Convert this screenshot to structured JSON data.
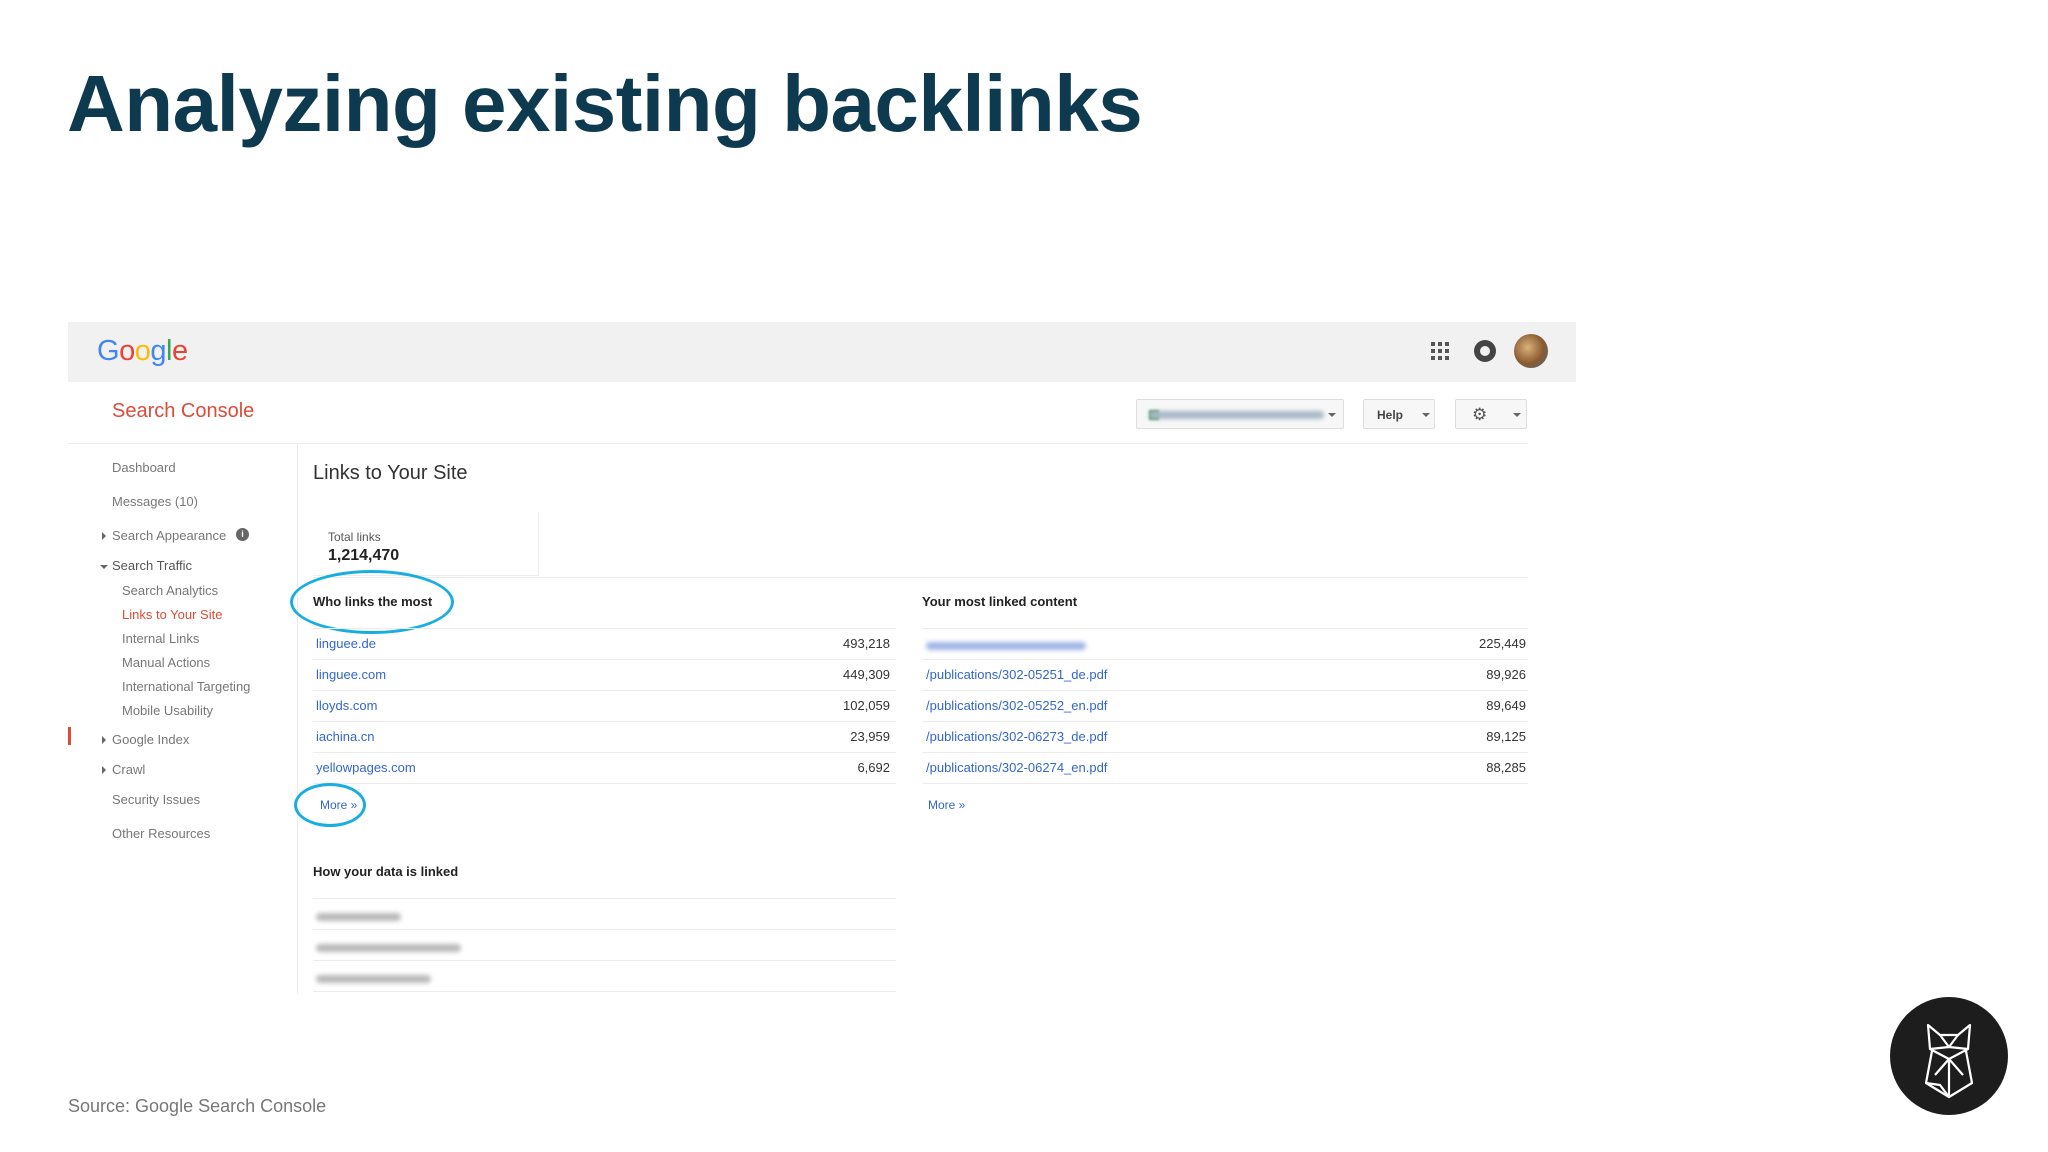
{
  "slide": {
    "title": "Analyzing existing backlinks",
    "source": "Source: Google Search Console"
  },
  "google_bar": {
    "logo_letters": [
      {
        "ch": "G",
        "color": "#4285f4"
      },
      {
        "ch": "o",
        "color": "#ea4335"
      },
      {
        "ch": "o",
        "color": "#fbbc05"
      },
      {
        "ch": "g",
        "color": "#4285f4"
      },
      {
        "ch": "l",
        "color": "#34a853"
      },
      {
        "ch": "e",
        "color": "#ea4335"
      }
    ],
    "icons": [
      "apps-grid-icon",
      "notifications-icon",
      "account-avatar"
    ]
  },
  "search_console": {
    "app_title": "Search Console",
    "help_label": "Help",
    "settings_icon": "gear-icon"
  },
  "sidebar": {
    "items": [
      {
        "label": "Dashboard"
      },
      {
        "label": "Messages (10)"
      },
      {
        "label": "Search Appearance"
      },
      {
        "label": "Search Traffic"
      },
      {
        "label": "Search Analytics"
      },
      {
        "label": "Links to Your Site"
      },
      {
        "label": "Internal Links"
      },
      {
        "label": "Manual Actions"
      },
      {
        "label": "International Targeting"
      },
      {
        "label": "Mobile Usability"
      },
      {
        "label": "Google Index"
      },
      {
        "label": "Crawl"
      },
      {
        "label": "Security Issues"
      },
      {
        "label": "Other Resources"
      }
    ],
    "active_item": "Links to Your Site",
    "info_badge": "i"
  },
  "main": {
    "page_title": "Links to Your Site",
    "total_links_label": "Total links",
    "total_links_value": "1,214,470",
    "who_links": {
      "heading": "Who links the most",
      "rows": [
        {
          "domain": "linguee.de",
          "count": "493,218"
        },
        {
          "domain": "linguee.com",
          "count": "449,309"
        },
        {
          "domain": "lloyds.com",
          "count": "102,059"
        },
        {
          "domain": "iachina.cn",
          "count": "23,959"
        },
        {
          "domain": "yellowpages.com",
          "count": "6,692"
        }
      ],
      "more_label": "More »"
    },
    "most_linked": {
      "heading": "Your most linked content",
      "rows": [
        {
          "page": "",
          "count": "225,449"
        },
        {
          "page": "/publications/302-05251_de.pdf",
          "count": "89,926"
        },
        {
          "page": "/publications/302-05252_en.pdf",
          "count": "89,649"
        },
        {
          "page": "/publications/302-06273_de.pdf",
          "count": "89,125"
        },
        {
          "page": "/publications/302-06274_en.pdf",
          "count": "88,285"
        }
      ],
      "more_label": "More »"
    },
    "how_linked": {
      "heading": "How your data is linked"
    }
  },
  "colors": {
    "title": "#0d3a4e",
    "search_console_red": "#dd4b39",
    "link_blue": "#3366cc",
    "highlight_circle": "#1aaee0"
  }
}
